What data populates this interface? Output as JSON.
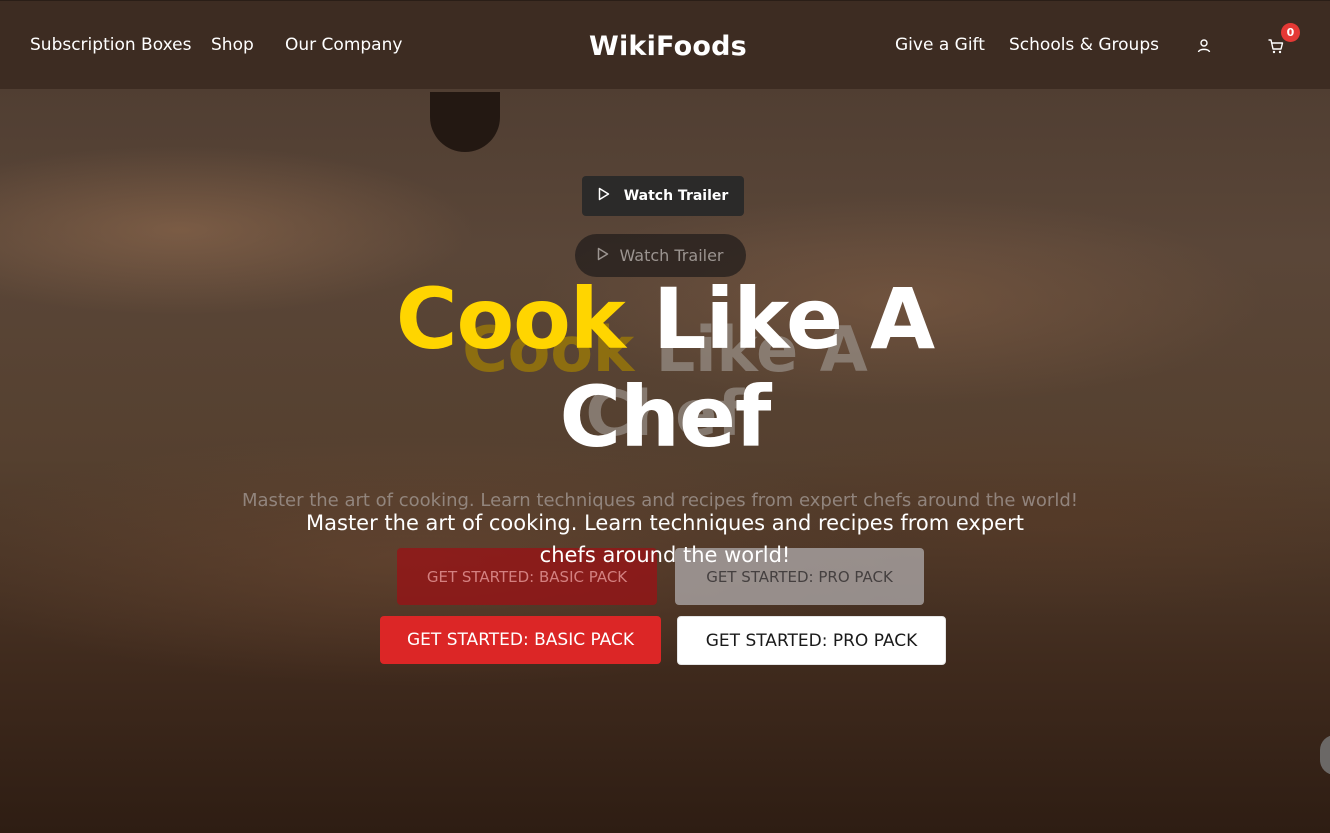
{
  "nav": {
    "left_links": [
      "Subscription Boxes",
      "Shop",
      "Our Company"
    ],
    "brand": "WikiFoods",
    "right_links": [
      "Give a Gift",
      "Schools & Groups"
    ],
    "cart_count": "0",
    "icons": {
      "account": "user-icon",
      "cart": "cart-icon"
    }
  },
  "hero": {
    "trailer_label": "Watch Trailer",
    "trailer_ghost_label": "Watch Trailer",
    "title_accent": "Cook",
    "title_rest": "Like A Chef",
    "title_ghost_accent": "Cook",
    "title_ghost_rest": "Like A Chef",
    "subtitle": "Master the art of cooking. Learn techniques and recipes from expert chefs around the world!",
    "subtitle_ghost": "Master the art of cooking. Learn techniques and recipes from expert chefs around the world!",
    "btn_basic": "GET STARTED: BASIC PACK",
    "btn_pro": "GET STARTED: PRO PACK",
    "btn_ghost_basic": "GET STARTED: BASIC PACK",
    "btn_ghost_pro": "GET STARTED: PRO PACK"
  },
  "colors": {
    "accent_yellow": "#ffd500",
    "primary_red": "#dc2626",
    "nav_bg": "#3d2c22",
    "badge_red": "#e53935"
  }
}
